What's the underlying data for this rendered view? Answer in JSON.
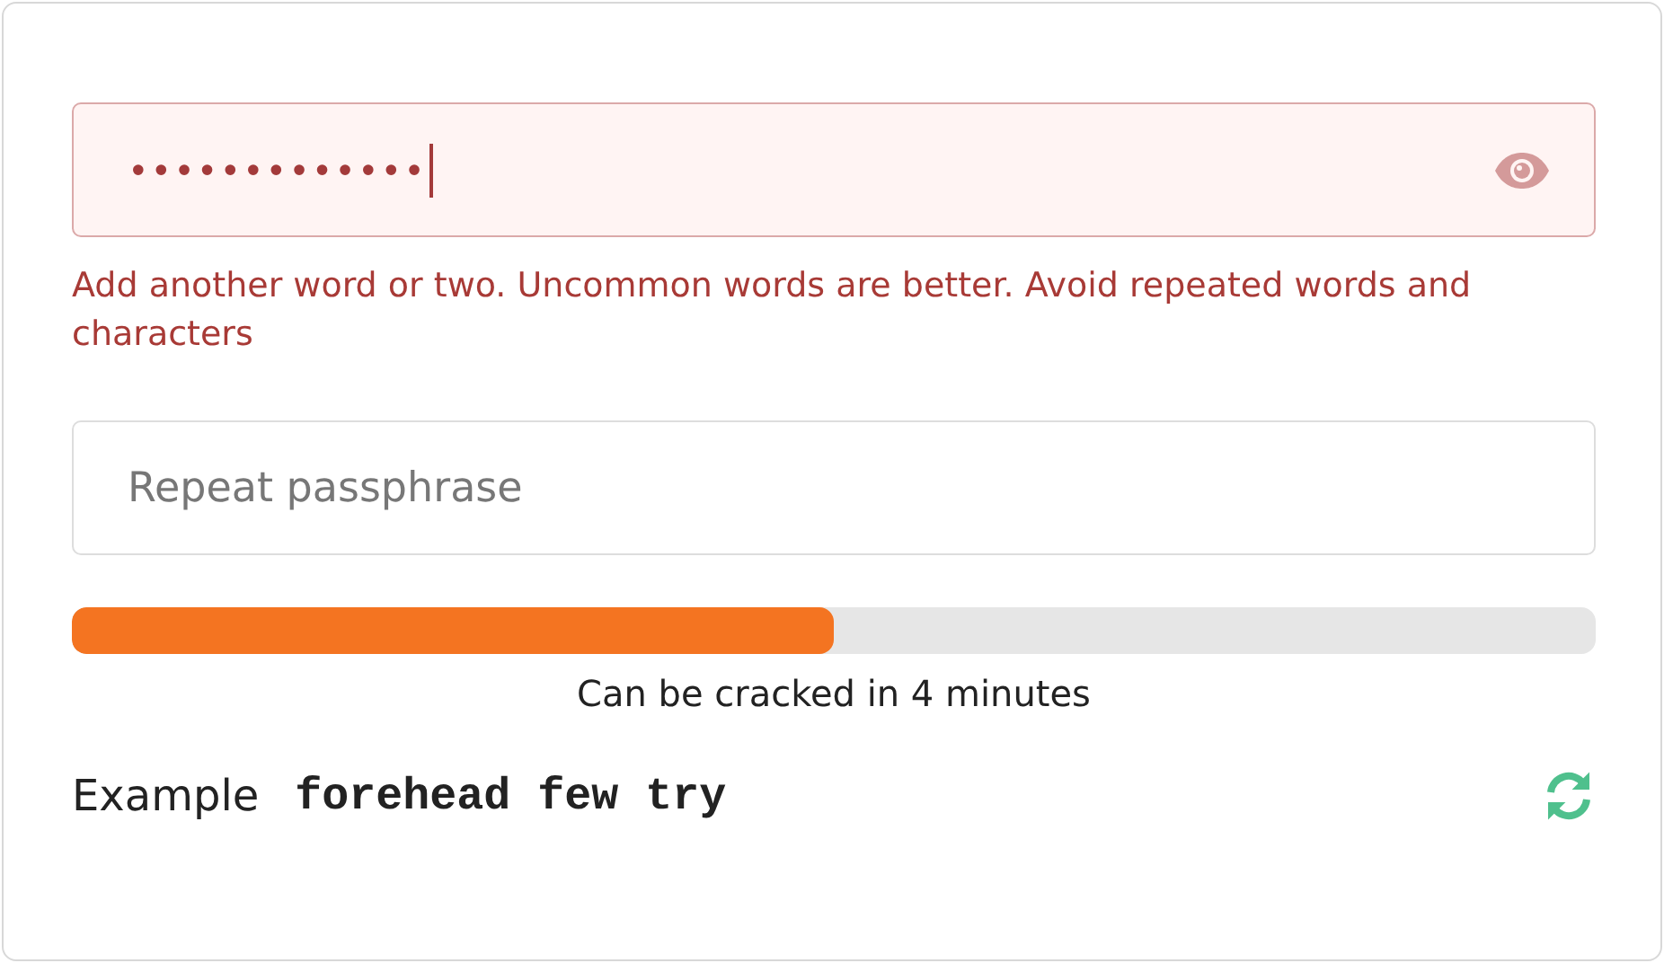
{
  "passphrase": {
    "value": "•••••••••••••",
    "error": true,
    "focused": true
  },
  "error_message": "Add another word or two. Uncommon words are better. Avoid repeated words and characters",
  "repeat": {
    "placeholder": "Repeat passphrase"
  },
  "strength": {
    "level": 0.5,
    "label": "Can be cracked in 4 minutes"
  },
  "example": {
    "label": "Example",
    "phrase": "forehead few try"
  }
}
